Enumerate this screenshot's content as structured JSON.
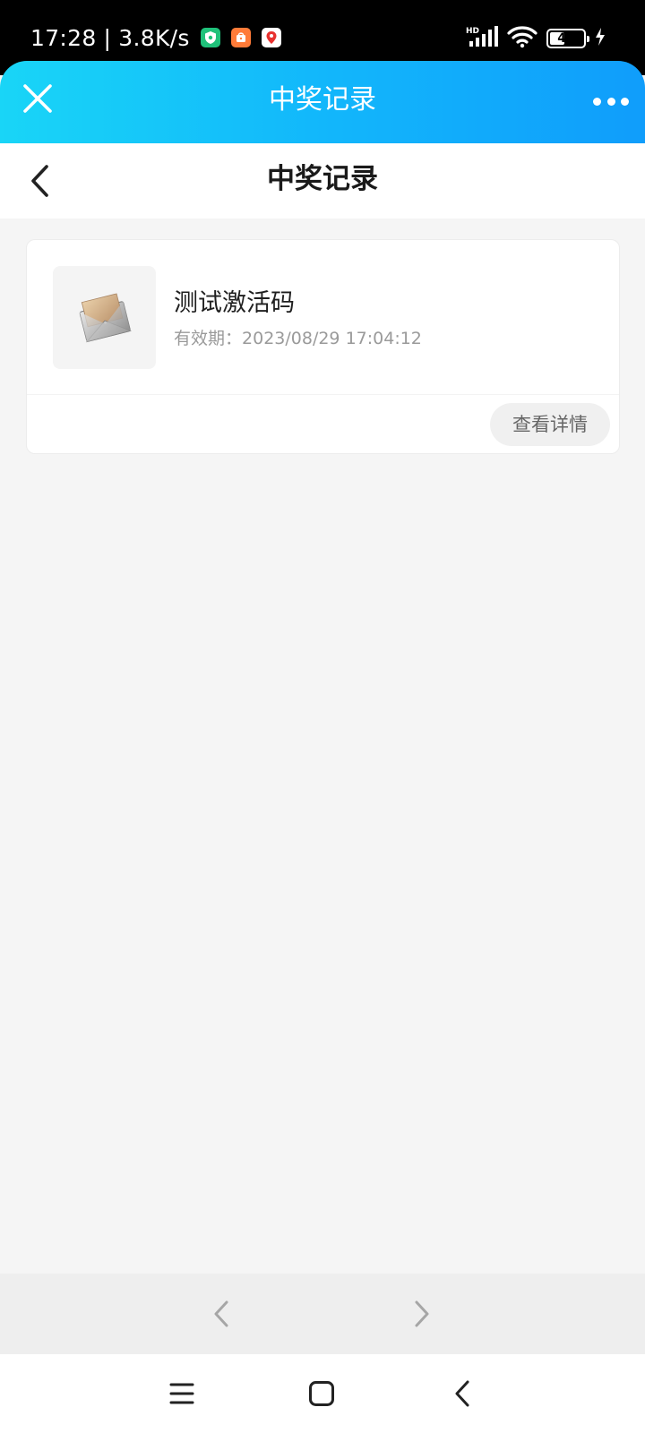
{
  "status_bar": {
    "time": "17:28",
    "separator": "|",
    "network_speed": "3.8K/s",
    "notification_icons": [
      "security-shield-icon",
      "shopping-bag-icon",
      "map-pin-icon"
    ],
    "signal_label": "HD",
    "battery_level": "45",
    "battery_fraction": 0.45,
    "charging": true
  },
  "title_bar": {
    "title": "中奖记录",
    "close_icon": "close-icon",
    "more_icon": "more-dots-icon",
    "gradient_start": "#19d5f7",
    "gradient_end": "#109dfb"
  },
  "page_header": {
    "title": "中奖记录",
    "back_icon": "chevron-left-icon"
  },
  "records": [
    {
      "name": "测试激活码",
      "validity_label": "有效期：",
      "validity_value": "2023/08/29 17:04:12",
      "thumb_icon": "envelope-icon",
      "action_label": "查看详情"
    }
  ],
  "browser_nav": {
    "back_icon": "chevron-left-icon",
    "forward_icon": "chevron-right-icon"
  },
  "system_nav": {
    "menu_icon": "menu-icon",
    "home_icon": "home-square-icon",
    "back_icon": "back-chevron-icon"
  }
}
